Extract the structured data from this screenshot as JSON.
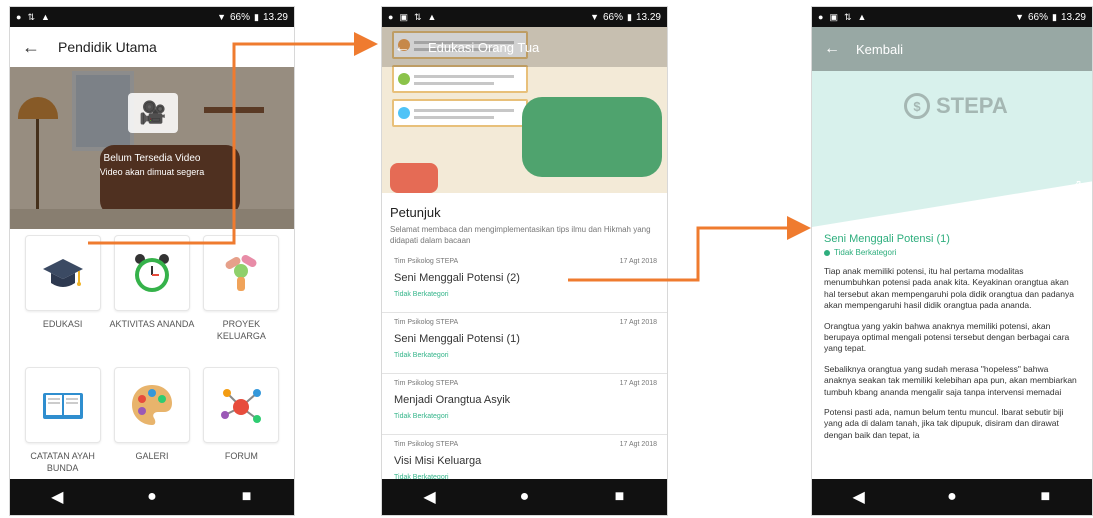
{
  "status_bar": {
    "battery": "66%",
    "time": "13.29"
  },
  "nav": {
    "back": "◀",
    "home": "●",
    "recent": "■"
  },
  "screen1": {
    "appbar_title": "Pendidik Utama",
    "video": {
      "line1": "Belum Tersedia Video",
      "line2": "Video akan dimuat segera"
    },
    "tiles": [
      {
        "label": "EDUKASI",
        "icon": "graduation-cap-icon"
      },
      {
        "label": "AKTIVITAS ANANDA",
        "icon": "alarm-clock-icon"
      },
      {
        "label": "PROYEK KELUARGA",
        "icon": "hands-icon"
      },
      {
        "label": "CATATAN AYAH BUNDA",
        "icon": "open-book-icon"
      },
      {
        "label": "GALERI",
        "icon": "palette-icon"
      },
      {
        "label": "FORUM",
        "icon": "network-icon"
      }
    ]
  },
  "screen2": {
    "appbar_title": "Edukasi Orang Tua",
    "petunjuk_title": "Petunjuk",
    "petunjuk_text": "Selamat membaca dan mengimplementasikan tips ilmu dan Hikmah yang didapati dalam bacaan",
    "articles": [
      {
        "author": "Tim Psikolog STEPA",
        "date": "17 Agt 2018",
        "title": "Seni Menggali Potensi (2)",
        "category": "Tidak Berkategori"
      },
      {
        "author": "Tim Psikolog STEPA",
        "date": "17 Agt 2018",
        "title": "Seni Menggali Potensi (1)",
        "category": "Tidak Berkategori"
      },
      {
        "author": "Tim Psikolog STEPA",
        "date": "17 Agt 2018",
        "title": "Menjadi Orangtua Asyik",
        "category": "Tidak Berkategori"
      },
      {
        "author": "Tim Psikolog STEPA",
        "date": "17 Agt 2018",
        "title": "Visi Misi Keluarga",
        "category": "Tidak Berkategori"
      }
    ]
  },
  "screen3": {
    "appbar_title": "Kembali",
    "logo_text": "STEPA",
    "article_title": "Seni Menggali Potensi (1)",
    "category": "Tidak Berkategori",
    "paragraphs": [
      "Tiap anak memiliki potensi, itu hal pertama modalitas menumbuhkan potensi pada anak kita. Keyakinan orangtua akan hal tersebut akan mempengaruhi pola didik orangtua dan padanya akan mempengaruhi hasil didik orangtua pada ananda.",
      "Orangtua yang yakin bahwa anaknya memiliki potensi, akan berupaya optimal mengali potensi tersebut dengan berbagai cara yang tepat.",
      "Sebaliknya orangtua yang sudah merasa \"hopeless\" bahwa anaknya seakan tak memiliki kelebihan apa pun, akan membiarkan tumbuh kbang ananda mengalir saja tanpa intervensi memadai",
      "Potensi pasti ada, namun belum tentu muncul. Ibarat sebutir biji yang ada di dalam tanah, jika tak dipupuk, disiram dan dirawat dengan baik dan tepat, ia"
    ]
  },
  "colors": {
    "arrow": "#ef7b2f",
    "accent_green": "#2eae7d"
  }
}
